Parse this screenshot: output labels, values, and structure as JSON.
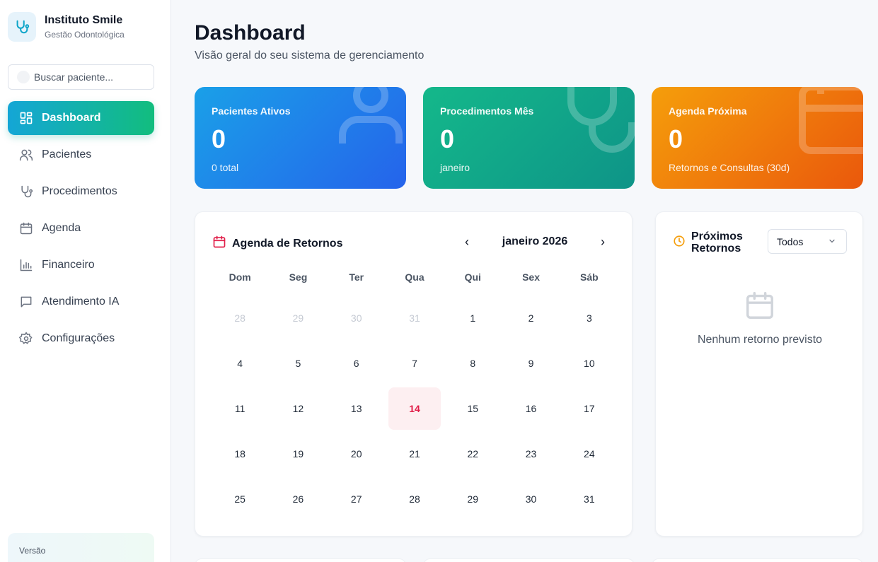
{
  "brand": {
    "title": "Instituto Smile",
    "subtitle": "Gestão Odontológica",
    "icon": "stethoscope-icon",
    "color": "#0ea5c9"
  },
  "search": {
    "placeholder": "Buscar paciente...",
    "value": ""
  },
  "nav": {
    "items": [
      {
        "label": "Dashboard",
        "icon": "dashboard-grid-icon",
        "active": true
      },
      {
        "label": "Pacientes",
        "icon": "users-icon",
        "active": false
      },
      {
        "label": "Procedimentos",
        "icon": "stethoscope-icon",
        "active": false
      },
      {
        "label": "Agenda",
        "icon": "calendar-icon",
        "active": false
      },
      {
        "label": "Financeiro",
        "icon": "bar-chart-icon",
        "active": false
      },
      {
        "label": "Atendimento IA",
        "icon": "message-icon",
        "active": false
      },
      {
        "label": "Configurações",
        "icon": "gear-icon",
        "active": false
      }
    ]
  },
  "version": {
    "label": "Versão"
  },
  "header": {
    "title": "Dashboard",
    "subtitle": "Visão geral do seu sistema de gerenciamento"
  },
  "stats": [
    {
      "label": "Pacientes Ativos",
      "value": "0",
      "sub": "0 total",
      "color": "#2563eb"
    },
    {
      "label": "Procedimentos Mês",
      "value": "0",
      "sub": "janeiro",
      "color": "#0e9488"
    },
    {
      "label": "Agenda Próxima",
      "value": "0",
      "sub": "Retornos e Consultas (30d)",
      "color": "#ea580c"
    }
  ],
  "calendar": {
    "title": "Agenda de Retornos",
    "month": "janeiro 2026",
    "prev": "‹",
    "next": "›",
    "weekdays": [
      "Dom",
      "Seg",
      "Ter",
      "Qua",
      "Qui",
      "Sex",
      "Sáb"
    ],
    "days": [
      {
        "d": "28",
        "muted": true
      },
      {
        "d": "29",
        "muted": true
      },
      {
        "d": "30",
        "muted": true
      },
      {
        "d": "31",
        "muted": true
      },
      {
        "d": "1"
      },
      {
        "d": "2"
      },
      {
        "d": "3"
      },
      {
        "d": "4"
      },
      {
        "d": "5"
      },
      {
        "d": "6"
      },
      {
        "d": "7"
      },
      {
        "d": "8"
      },
      {
        "d": "9"
      },
      {
        "d": "10"
      },
      {
        "d": "11"
      },
      {
        "d": "12"
      },
      {
        "d": "13"
      },
      {
        "d": "14",
        "today": true
      },
      {
        "d": "15"
      },
      {
        "d": "16"
      },
      {
        "d": "17"
      },
      {
        "d": "18"
      },
      {
        "d": "19"
      },
      {
        "d": "20"
      },
      {
        "d": "21"
      },
      {
        "d": "22"
      },
      {
        "d": "23"
      },
      {
        "d": "24"
      },
      {
        "d": "25"
      },
      {
        "d": "26"
      },
      {
        "d": "27"
      },
      {
        "d": "28"
      },
      {
        "d": "29"
      },
      {
        "d": "30"
      },
      {
        "d": "31"
      }
    ],
    "today_color": "#e11d48"
  },
  "returns": {
    "title": "Próximos Retornos",
    "filter": "Todos",
    "empty": "Nenhum retorno previsto",
    "accent": "#f59e0b"
  }
}
